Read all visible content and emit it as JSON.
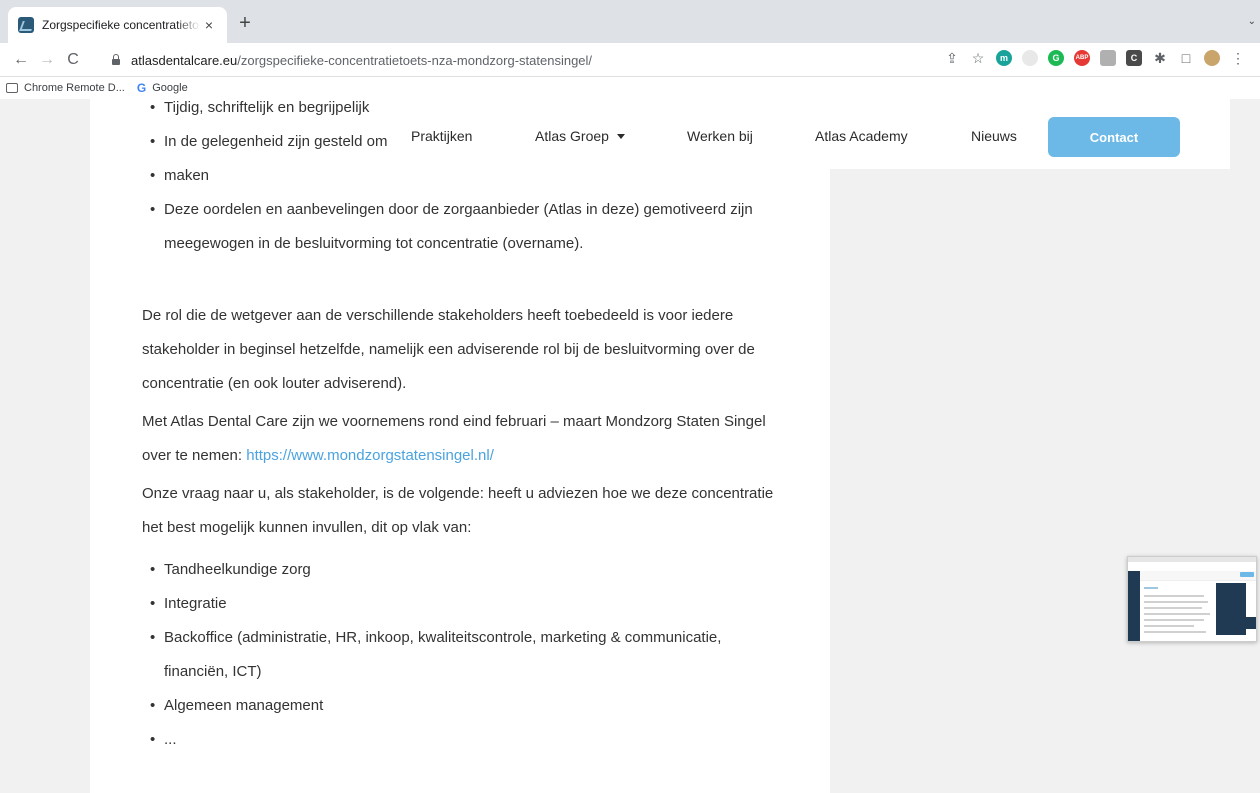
{
  "browser": {
    "tab": {
      "title": "Zorgspecifieke concentratietoets",
      "close": "×"
    },
    "new_tab": "+",
    "tab_search": "⌄",
    "nav": {
      "back": "←",
      "forward": "→",
      "reload": "C"
    },
    "url_host": "atlasdentalcare.eu",
    "url_path": "/zorgspecifieke-concentratietoets-nza-mondzorg-statensingel/",
    "bookmarks": [
      {
        "label": "Chrome Remote D..."
      },
      {
        "label": "Google"
      }
    ],
    "extensions": [
      "m",
      "G",
      "ABP",
      "C"
    ]
  },
  "site_nav": {
    "items": [
      "Praktijken",
      "Atlas Groep",
      "Werken bij",
      "Atlas Academy",
      "Nieuws"
    ],
    "contact": "Contact"
  },
  "article": {
    "top_bullets": [
      "Tijdig, schriftelijk en begrijpelijk",
      "In de gelegenheid zijn gesteld om een advies te",
      "maken",
      "Deze oordelen en aanbevelingen door de zorgaanbieder (Atlas in deze) gemotiveerd zijn meegewogen in de besluitvorming tot concentratie (overname)."
    ],
    "para1": "De rol die de wetgever aan de verschillende stakeholders heeft toebedeeld is voor iedere stakeholder in beginsel hetzelfde, namelijk een adviserende rol bij de besluitvorming over de concentratie (en ook louter adviserend).",
    "para2_text": "Met Atlas Dental Care zijn we voornemens rond eind februari – maart Mondzorg Staten Singel over te nemen: ",
    "para2_link": "https://www.mondzorgstatensingel.nl/",
    "para3": "Onze vraag naar u, als stakeholder, is de volgende: heeft u adviezen hoe we deze concentratie het best mogelijk kunnen invullen, dit op vlak van:",
    "bottom_bullets": [
      "Tandheelkundige zorg",
      "Integratie",
      "Backoffice (administratie, HR, inkoop, kwaliteitscontrole, marketing & communicatie, financiën, ICT)",
      "Algemeen management",
      "..."
    ]
  },
  "colors": {
    "accent": "#6cb8e6",
    "link": "#4aa3df",
    "dark_navy": "#1f3a52"
  }
}
